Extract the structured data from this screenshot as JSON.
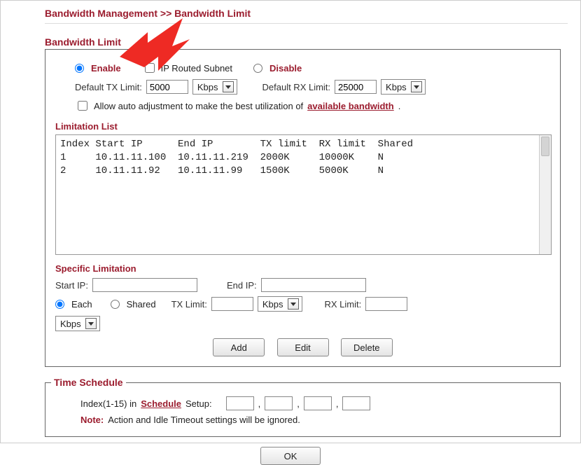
{
  "breadcrumb": "Bandwidth Management >> Bandwidth Limit",
  "section_title": "Bandwidth Limit",
  "mode": {
    "enable_label": "Enable",
    "ip_routed_label": "IP Routed Subnet",
    "disable_label": "Disable",
    "selected": "enable"
  },
  "defaults": {
    "tx_label": "Default TX Limit:",
    "tx_value": "5000",
    "tx_unit": "Kbps",
    "rx_label": "Default RX Limit:",
    "rx_value": "25000",
    "rx_unit": "Kbps"
  },
  "auto_adjust": {
    "checked": false,
    "text_before": "Allow auto adjustment to make the best utilization of ",
    "link_text": "available bandwidth",
    "text_after": "."
  },
  "limitation_list": {
    "heading": "Limitation List",
    "header": "Index Start IP      End IP        TX limit  RX limit  Shared",
    "rows": [
      "1     10.11.11.100  10.11.11.219  2000K     10000K    N",
      "2     10.11.11.92   10.11.11.99   1500K     5000K     N"
    ]
  },
  "specific": {
    "heading": "Specific Limitation",
    "start_ip_label": "Start IP:",
    "start_ip_value": "",
    "end_ip_label": "End IP:",
    "end_ip_value": "",
    "each_label": "Each",
    "shared_label": "Shared",
    "tx_label": "TX Limit:",
    "tx_value": "",
    "tx_unit": "Kbps",
    "rx_label": "RX Limit:",
    "rx_value": "",
    "rx_unit": "Kbps",
    "btn_add": "Add",
    "btn_edit": "Edit",
    "btn_delete": "Delete"
  },
  "schedule": {
    "legend": "Time Schedule",
    "label_before": "Index(1-15) in ",
    "link": "Schedule",
    "label_after": " Setup:",
    "sep": ",",
    "v1": "",
    "v2": "",
    "v3": "",
    "v4": "",
    "note_label": "Note:",
    "note_text": " Action and Idle Timeout settings will be ignored."
  },
  "ok_button": "OK"
}
